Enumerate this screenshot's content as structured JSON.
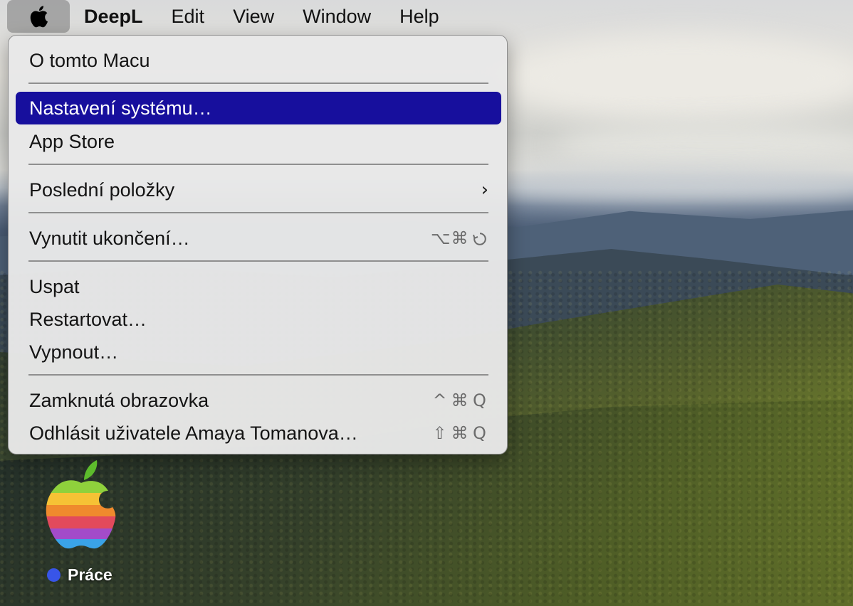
{
  "menubar": {
    "apple_icon": "apple-logo-icon",
    "items": [
      "DeepL",
      "Edit",
      "View",
      "Window",
      "Help"
    ]
  },
  "apple_menu": {
    "items": [
      {
        "label": "O tomto Macu"
      },
      {
        "label": "Nastavení systému…",
        "highlighted": true
      },
      {
        "label": "App Store"
      },
      {
        "label": "Poslední položky",
        "submenu_icon": "chevron-right-icon",
        "submenu_glyph": "›"
      },
      {
        "label": "Vynutit ukončení…",
        "shortcut": [
          "⌥",
          "⌘",
          "↻"
        ]
      },
      {
        "label": "Uspat"
      },
      {
        "label": "Restartovat…"
      },
      {
        "label": "Vypnout…"
      },
      {
        "label": "Zamknutá obrazovka",
        "shortcut": [
          "^",
          "⌘",
          "Q"
        ]
      },
      {
        "label": "Odhlásit uživatele Amaya Tomanova…",
        "shortcut": [
          "⇧",
          "⌘",
          "Q"
        ]
      }
    ],
    "highlight_color": "#170f9d"
  },
  "desktop": {
    "icon": {
      "name": "rainbow-apple-icon",
      "label": "Práce",
      "tag_color": "#3855e8"
    }
  }
}
